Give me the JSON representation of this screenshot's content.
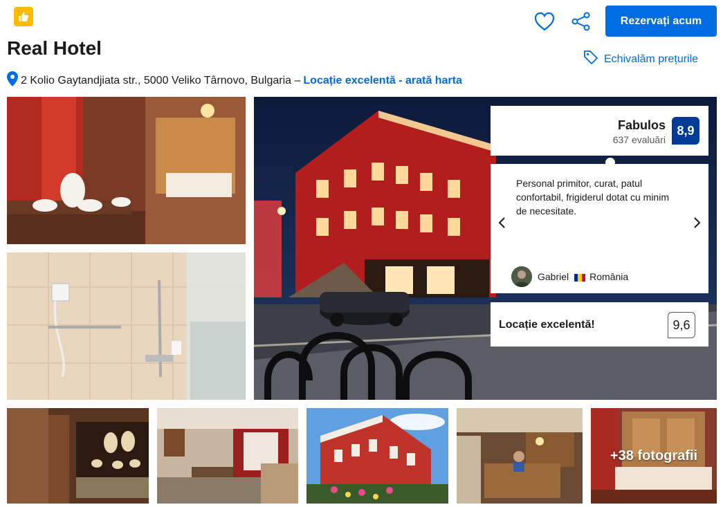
{
  "header": {
    "hotel_name": "Real Hotel",
    "address": "2 Kolio Gaytandjiata str., 5000 Veliko Târnovo, Bulgaria –",
    "location_link": "Locație excelentă - arată harta",
    "reserve_label": "Rezervați acum",
    "price_match_label": "Echivalăm prețurile"
  },
  "review_score": {
    "label": "Fabulos",
    "count": "637 evaluări",
    "score": "8,9"
  },
  "featured_review": {
    "text": "Personal primitor, curat, patul confortabil, frigiderul dotat cu minim de necesitate.",
    "reviewer_name": "Gabriel",
    "reviewer_country": "România"
  },
  "location_rating": {
    "label": "Locație excelentă!",
    "score": "9,6"
  },
  "gallery": {
    "more_photos_label": "+38 fotografii"
  },
  "icons": [
    "thumbs-up-icon",
    "location-pin-icon",
    "heart-icon",
    "share-icon",
    "tag-icon",
    "chevron-left-icon",
    "chevron-right-icon"
  ],
  "colors": {
    "accent": "#006ce4",
    "score": "#003b95",
    "badge": "#febb02"
  }
}
